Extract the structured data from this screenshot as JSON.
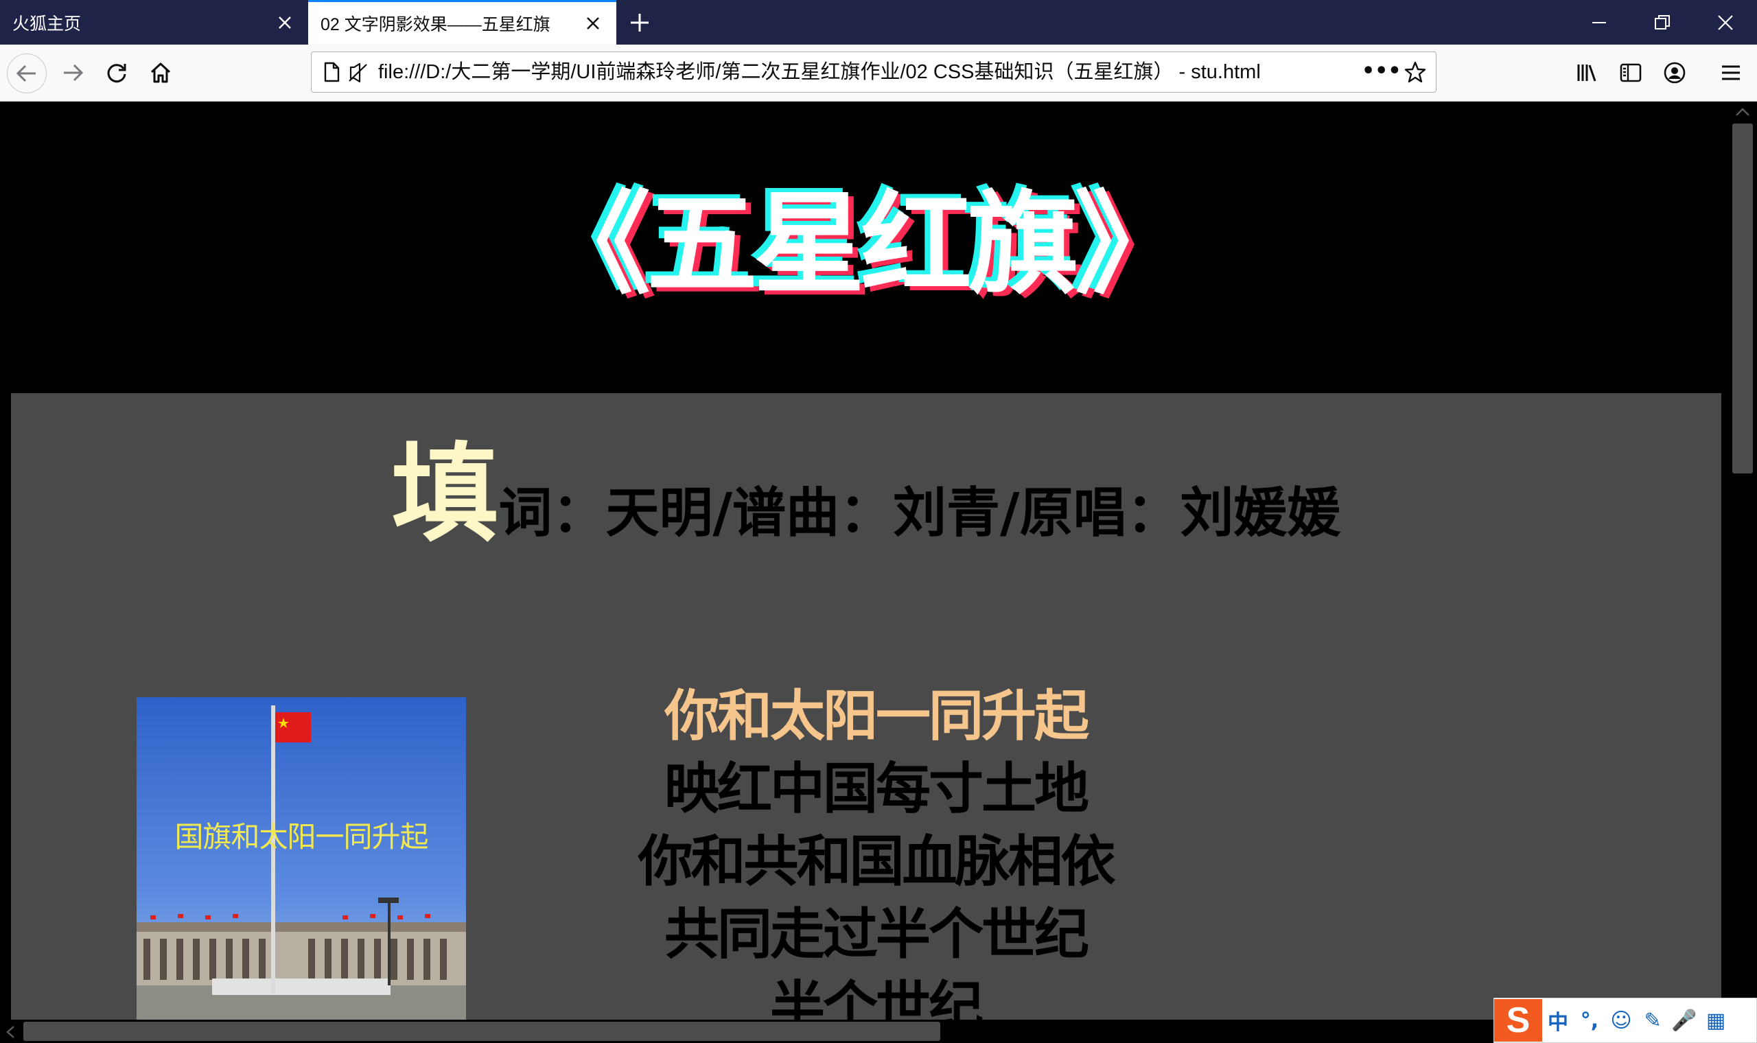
{
  "browser": {
    "tabs": [
      {
        "title": "火狐主页",
        "active": false
      },
      {
        "title": "02 文字阴影效果——五星红旗",
        "active": true
      }
    ],
    "url": "file:///D:/大二第一学期/UI前端森玲老师/第二次五星红旗作业/02 CSS基础知识（五星红旗） - stu.html",
    "url_more": "•••"
  },
  "page": {
    "title": "《五星红旗》",
    "title_shadow_colors": [
      "#25f4ee",
      "#fe2c55"
    ],
    "background": "#000000",
    "panel_color": "#4a4a4a",
    "credit_first_char": "填",
    "credit_rest": "词：天明/谱曲：刘青/原唱：刘媛媛",
    "photo_caption": "国旗和太阳一同升起",
    "lyrics": [
      "你和太阳一同升起",
      "映红中国每寸土地",
      "你和共和国血脉相依",
      "共同走过半个世纪",
      "半个世纪"
    ],
    "highlight_color": "#f6c58c"
  },
  "ime": {
    "logo": "S",
    "items": [
      "中",
      "°,",
      "☺",
      "✎",
      "🎤",
      "▦"
    ]
  }
}
